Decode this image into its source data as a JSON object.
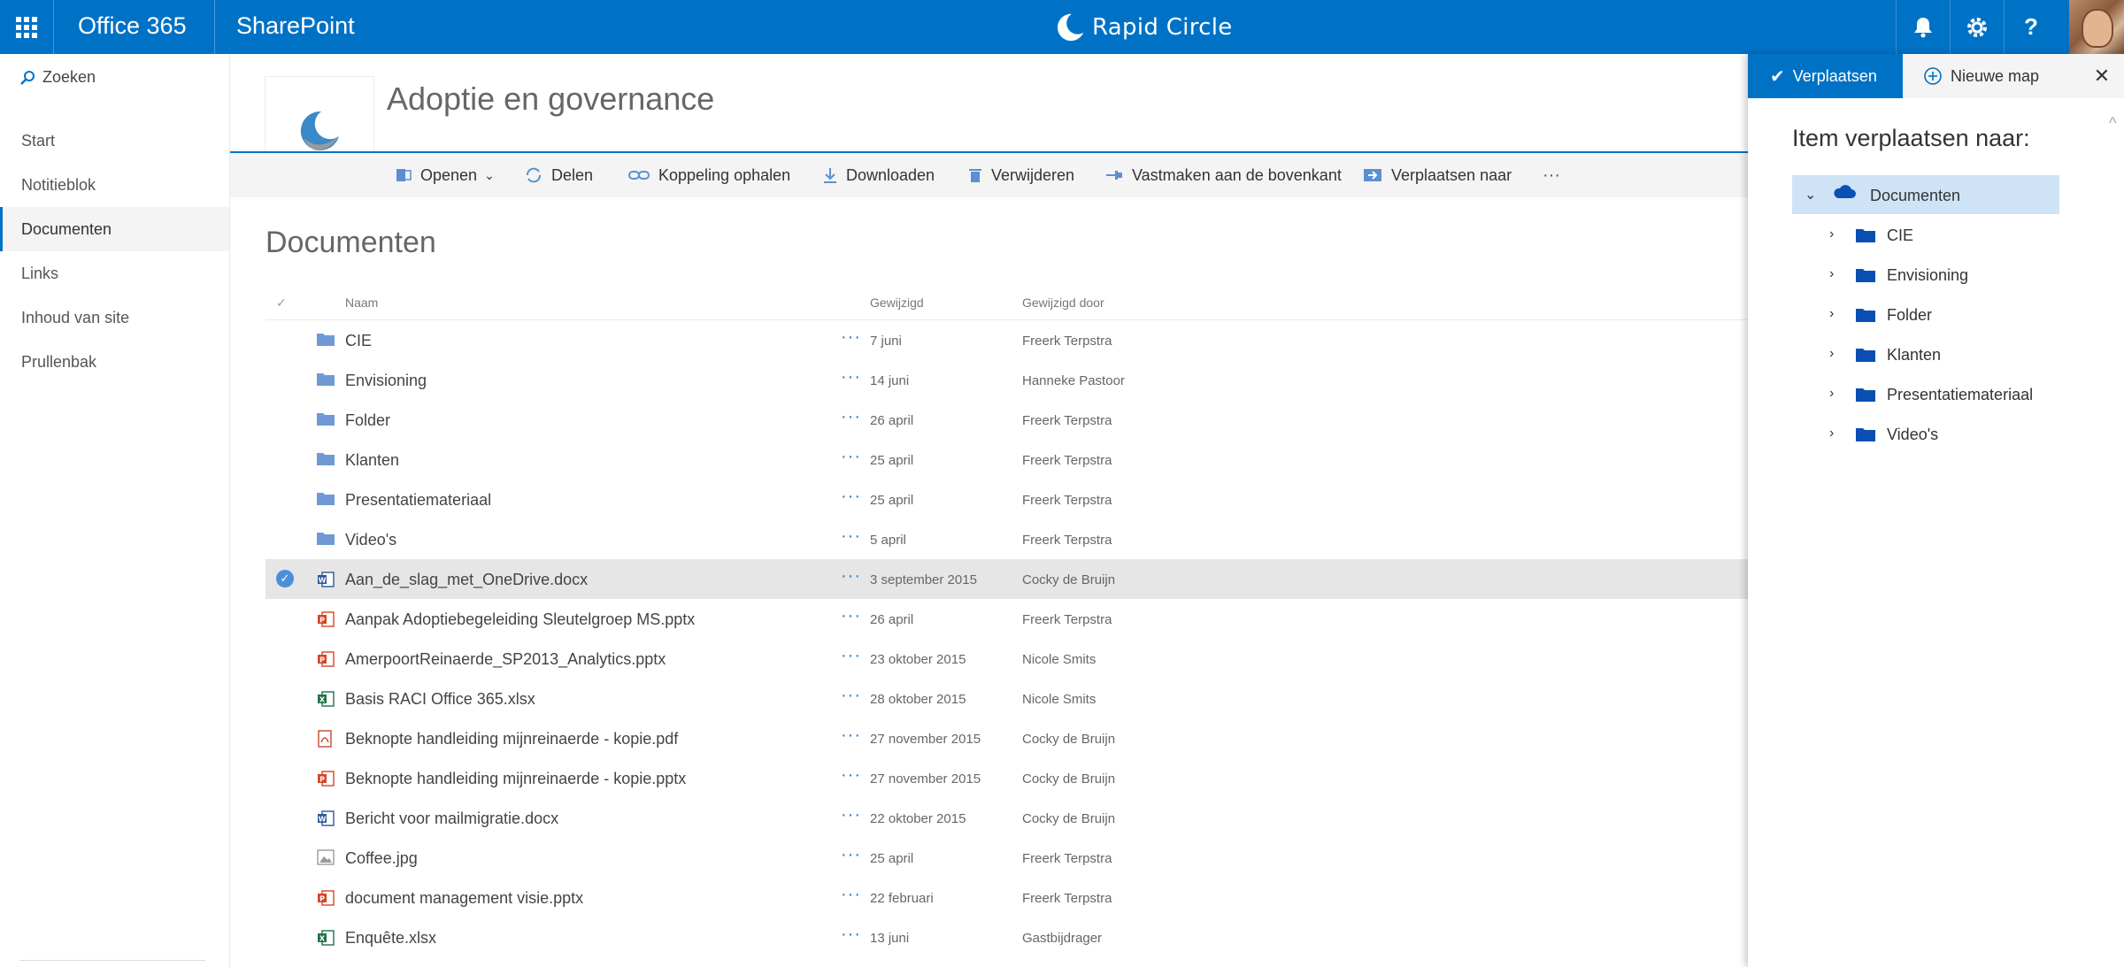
{
  "suitebar": {
    "brand": "Office 365",
    "app": "SharePoint",
    "center_logo_text": "Rapid Circle",
    "icons": [
      "waffle-icon",
      "bell-icon",
      "gear-icon",
      "help-icon"
    ],
    "help_glyph": "?"
  },
  "nav": {
    "search_placeholder": "Zoeken",
    "items": [
      "Start",
      "Notitieblok",
      "Documenten",
      "Links",
      "Inhoud van site",
      "Prullenbak"
    ],
    "active": "Documenten"
  },
  "site": {
    "title": "Adoptie en governance"
  },
  "commands": {
    "open": "Openen",
    "share": "Delen",
    "get_link": "Koppeling ophalen",
    "download": "Downloaden",
    "delete": "Verwijderen",
    "pin": "Vastmaken aan de bovenkant",
    "move": "Verplaatsen naar",
    "more": "···"
  },
  "library": {
    "title": "Documenten",
    "columns": {
      "name": "Naam",
      "modified": "Gewijzigd",
      "modified_by": "Gewijzigd door"
    },
    "row_actions": "···",
    "rows": [
      {
        "type": "folder",
        "name": "CIE",
        "modified": "7 juni",
        "by": "Freerk Terpstra"
      },
      {
        "type": "folder",
        "name": "Envisioning",
        "modified": "14 juni",
        "by": "Hanneke Pastoor"
      },
      {
        "type": "folder",
        "name": "Folder",
        "modified": "26 april",
        "by": "Freerk Terpstra"
      },
      {
        "type": "folder",
        "name": "Klanten",
        "modified": "25 april",
        "by": "Freerk Terpstra"
      },
      {
        "type": "folder",
        "name": "Presentatiemateriaal",
        "modified": "25 april",
        "by": "Freerk Terpstra"
      },
      {
        "type": "folder",
        "name": "Video's",
        "modified": "5 april",
        "by": "Freerk Terpstra"
      },
      {
        "type": "docx",
        "name": "Aan_de_slag_met_OneDrive.docx",
        "modified": "3 september 2015",
        "by": "Cocky de Bruijn",
        "selected": true
      },
      {
        "type": "pptx",
        "name": "Aanpak Adoptiebegeleiding Sleutelgroep MS.pptx",
        "modified": "26 april",
        "by": "Freerk Terpstra"
      },
      {
        "type": "pptx",
        "name": "AmerpoortReinaerde_SP2013_Analytics.pptx",
        "modified": "23 oktober 2015",
        "by": "Nicole Smits"
      },
      {
        "type": "xlsx",
        "name": "Basis RACI Office 365.xlsx",
        "modified": "28 oktober 2015",
        "by": "Nicole Smits"
      },
      {
        "type": "pdf",
        "name": "Beknopte handleiding mijnreinaerde - kopie.pdf",
        "modified": "27 november 2015",
        "by": "Cocky de Bruijn"
      },
      {
        "type": "pptx",
        "name": "Beknopte handleiding mijnreinaerde - kopie.pptx",
        "modified": "27 november 2015",
        "by": "Cocky de Bruijn"
      },
      {
        "type": "docx",
        "name": "Bericht voor mailmigratie.docx",
        "modified": "22 oktober 2015",
        "by": "Cocky de Bruijn"
      },
      {
        "type": "jpg",
        "name": "Coffee.jpg",
        "modified": "25 april",
        "by": "Freerk Terpstra"
      },
      {
        "type": "pptx",
        "name": "document management visie.pptx",
        "modified": "22 februari",
        "by": "Freerk Terpstra"
      },
      {
        "type": "xlsx",
        "name": "Enquête.xlsx",
        "modified": "13 juni",
        "by": "Gastbijdrager"
      }
    ]
  },
  "panel": {
    "move_label": "Verplaatsen",
    "new_folder_label": "Nieuwe map",
    "close_glyph": "✕",
    "heading": "Item verplaatsen naar:",
    "root": "Documenten",
    "folders": [
      "CIE",
      "Envisioning",
      "Folder",
      "Klanten",
      "Presentatiemateriaal",
      "Video's"
    ]
  },
  "colors": {
    "brand_blue": "#0072c6",
    "selected_row": "#e6e6e6",
    "tree_selected": "#cfe3f6",
    "folder_list": "#6f9ad6",
    "folder_tree": "#0b4fb3",
    "word": "#2b5797",
    "powerpoint": "#d24726",
    "excel": "#207245",
    "pdf": "#c8472f"
  }
}
